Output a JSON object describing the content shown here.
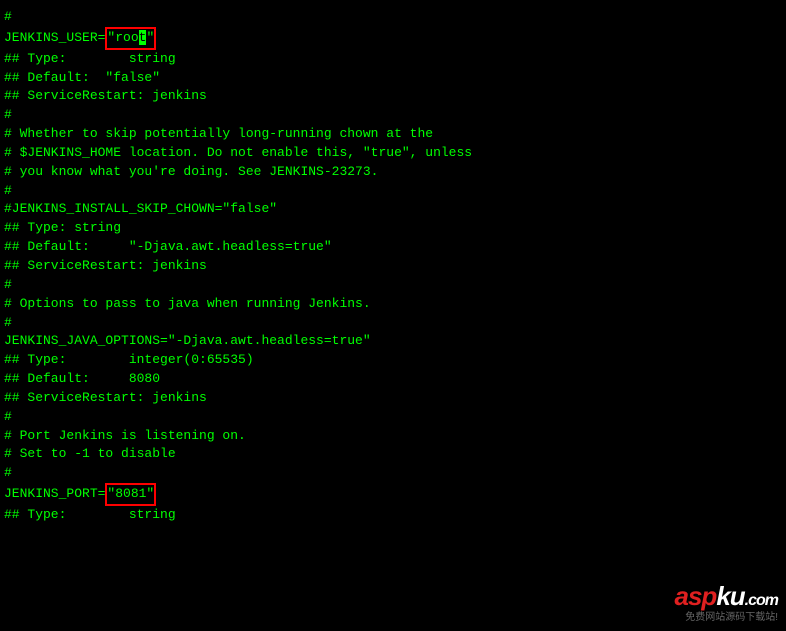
{
  "lines": {
    "l0": "#",
    "l1_prefix": "JENKINS_USER=",
    "l1_box_pre": "\"roo",
    "l1_box_cursor": "t",
    "l1_box_post": "\"",
    "l2": "",
    "l3": "## Type:        string",
    "l4": "## Default:  \"false\"",
    "l5": "## ServiceRestart: jenkins",
    "l6": "#",
    "l7": "# Whether to skip potentially long-running chown at the",
    "l8": "# $JENKINS_HOME location. Do not enable this, \"true\", unless",
    "l9": "# you know what you're doing. See JENKINS-23273.",
    "l10": "#",
    "l11": "#JENKINS_INSTALL_SKIP_CHOWN=\"false\"",
    "l12": "",
    "l13": "## Type: string",
    "l14": "## Default:     \"-Djava.awt.headless=true\"",
    "l15": "## ServiceRestart: jenkins",
    "l16": "#",
    "l17": "# Options to pass to java when running Jenkins.",
    "l18": "#",
    "l19": "JENKINS_JAVA_OPTIONS=\"-Djava.awt.headless=true\"",
    "l20": "",
    "l21": "## Type:        integer(0:65535)",
    "l22": "## Default:     8080",
    "l23": "## ServiceRestart: jenkins",
    "l24": "#",
    "l25": "# Port Jenkins is listening on.",
    "l26": "# Set to -1 to disable",
    "l27": "#",
    "l28_prefix": "JENKINS_PORT=",
    "l28_box": "\"8081\"",
    "l29": "",
    "l30": "## Type:        string"
  },
  "watermark": {
    "red": "asp",
    "outline": "ku",
    "suffix": ".com",
    "sub": "免费网站源码下载站!"
  }
}
